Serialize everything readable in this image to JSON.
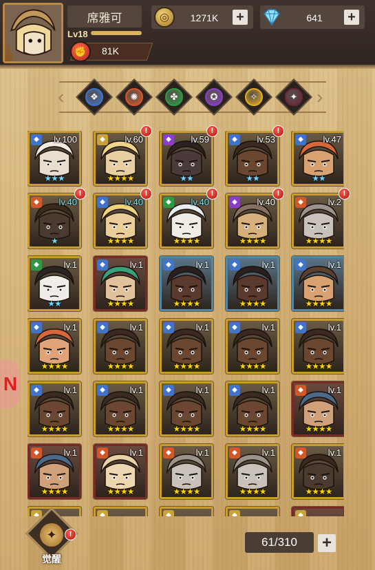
{
  "player": {
    "name": "席雅可",
    "level": "Lv18",
    "xp_fraction": 1.0,
    "power": "81K"
  },
  "resources": {
    "gold": {
      "value": "1271K",
      "icon": "gold-coin-icon"
    },
    "diamond": {
      "value": "641",
      "icon": "diamond-icon"
    }
  },
  "filters": [
    {
      "name": "element-water",
      "color": "#3f74c8",
      "glyph": "❖"
    },
    {
      "name": "element-fire",
      "color": "#d2582a",
      "glyph": "✺"
    },
    {
      "name": "element-nature",
      "color": "#2f9a46",
      "glyph": "✤"
    },
    {
      "name": "element-dark",
      "color": "#8a3fc4",
      "glyph": "✪"
    },
    {
      "name": "element-light",
      "color": "#e2ad1e",
      "glyph": "✧"
    },
    {
      "name": "element-shadow",
      "color": "#6a2a3a",
      "glyph": "✦"
    }
  ],
  "heroes": [
    {
      "lvl": "lv.100",
      "stars": "★★★",
      "starColor": "blue",
      "frame": "gold",
      "cls": "#3f74c8",
      "face": "#e9ddd0",
      "hair": "#f2ede4",
      "lvlColor": "white",
      "badge": false
    },
    {
      "lvl": "lv.60",
      "stars": "★★★★",
      "starColor": "gold",
      "frame": "gold",
      "cls": "#c9a23a",
      "face": "#e8cfa2",
      "hair": "#efd58a",
      "lvlColor": "white",
      "badge": true
    },
    {
      "lvl": "lv.59",
      "stars": "★★",
      "starColor": "blue",
      "frame": "gold",
      "cls": "#8a3fc4",
      "face": "#4a3a3a",
      "hair": "#2b2222",
      "lvlColor": "white",
      "badge": true
    },
    {
      "lvl": "lv.53",
      "stars": "★★",
      "starColor": "blue",
      "frame": "gold",
      "cls": "#3f74c8",
      "face": "#6b4631",
      "hair": "#3a2a22",
      "lvlColor": "white",
      "badge": true
    },
    {
      "lvl": "lv.47",
      "stars": "★★",
      "starColor": "blue",
      "frame": "gold",
      "cls": "#3f74c8",
      "face": "#d9a070",
      "hair": "#d6673a",
      "lvlColor": "white",
      "badge": false
    },
    {
      "lvl": "lv.40",
      "stars": "★",
      "starColor": "blue",
      "frame": "gold",
      "cls": "#d2582a",
      "face": "#4a3a30",
      "hair": "#3a2a1e",
      "lvlColor": "cyan",
      "badge": true
    },
    {
      "lvl": "lv.40",
      "stars": "★★★★",
      "starColor": "gold",
      "frame": "gold",
      "cls": "#3f74c8",
      "face": "#e9ce9a",
      "hair": "#f0d27a",
      "lvlColor": "cyan",
      "badge": true
    },
    {
      "lvl": "lv.40",
      "stars": "★★★★",
      "starColor": "gold",
      "frame": "gold",
      "cls": "#2f9a46",
      "face": "#f2ece6",
      "hair": "#e8eef2",
      "lvlColor": "cyan",
      "badge": true
    },
    {
      "lvl": "lv.40",
      "stars": "★★★★",
      "starColor": "gold",
      "frame": "gold",
      "cls": "#8a3fc4",
      "face": "#d5b07a",
      "hair": "#8a7060",
      "lvlColor": "white",
      "badge": true
    },
    {
      "lvl": "lv.2",
      "stars": "★★★★",
      "starColor": "gold",
      "frame": "gold",
      "cls": "#d2582a",
      "face": "#c8c2bb",
      "hair": "#9a938c",
      "lvlColor": "white",
      "badge": true
    },
    {
      "lvl": "lv.1",
      "stars": "★★",
      "starColor": "blue",
      "frame": "gold",
      "cls": "#2f9a46",
      "face": "#f0ede8",
      "hair": "#2b2523",
      "lvlColor": "white",
      "badge": false
    },
    {
      "lvl": "lv.1",
      "stars": "★★★★",
      "starColor": "gold",
      "frame": "red",
      "cls": "#3f74c8",
      "face": "#e2c29a",
      "hair": "#3aa07c",
      "lvlColor": "white",
      "badge": false
    },
    {
      "lvl": "lv.1",
      "stars": "★★★★",
      "starColor": "gold",
      "frame": "blue",
      "cls": "#3f74c8",
      "face": "#5a3a2c",
      "hair": "#2a2020",
      "lvlColor": "white",
      "badge": false
    },
    {
      "lvl": "lv.1",
      "stars": "★★★★",
      "starColor": "gold",
      "frame": "blue",
      "cls": "#3f74c8",
      "face": "#5a3a2c",
      "hair": "#2a2020",
      "lvlColor": "white",
      "badge": false
    },
    {
      "lvl": "lv.1",
      "stars": "★★★★",
      "starColor": "gold",
      "frame": "blue",
      "cls": "#3f74c8",
      "face": "#d9a070",
      "hair": "#5a4030",
      "lvlColor": "white",
      "badge": false
    },
    {
      "lvl": "lv.1",
      "stars": "★★★★",
      "starColor": "gold",
      "frame": "gold",
      "cls": "#3f74c8",
      "face": "#e0a478",
      "hair": "#d6673a",
      "lvlColor": "white",
      "badge": false
    },
    {
      "lvl": "lv.1",
      "stars": "★★★★",
      "starColor": "gold",
      "frame": "gold",
      "cls": "#3f74c8",
      "face": "#6b4631",
      "hair": "#3a2a22",
      "lvlColor": "white",
      "badge": false
    },
    {
      "lvl": "lv.1",
      "stars": "★★★★",
      "starColor": "gold",
      "frame": "gold",
      "cls": "#3f74c8",
      "face": "#6b4631",
      "hair": "#3a2a22",
      "lvlColor": "white",
      "badge": false
    },
    {
      "lvl": "lv.1",
      "stars": "★★★★",
      "starColor": "gold",
      "frame": "gold",
      "cls": "#3f74c8",
      "face": "#6b4631",
      "hair": "#3a2a22",
      "lvlColor": "white",
      "badge": false
    },
    {
      "lvl": "lv.1",
      "stars": "★★★★",
      "starColor": "gold",
      "frame": "gold",
      "cls": "#3f74c8",
      "face": "#6b4631",
      "hair": "#3a2a22",
      "lvlColor": "white",
      "badge": false
    },
    {
      "lvl": "lv.1",
      "stars": "★★★★",
      "starColor": "gold",
      "frame": "gold",
      "cls": "#3f74c8",
      "face": "#6b4631",
      "hair": "#3a2a22",
      "lvlColor": "white",
      "badge": false
    },
    {
      "lvl": "lv.1",
      "stars": "★★★★",
      "starColor": "gold",
      "frame": "gold",
      "cls": "#3f74c8",
      "face": "#6b4631",
      "hair": "#3a2a22",
      "lvlColor": "white",
      "badge": false
    },
    {
      "lvl": "lv.1",
      "stars": "★★★★",
      "starColor": "gold",
      "frame": "gold",
      "cls": "#3f74c8",
      "face": "#6b4631",
      "hair": "#3a2a22",
      "lvlColor": "white",
      "badge": false
    },
    {
      "lvl": "lv.1",
      "stars": "★★★★",
      "starColor": "gold",
      "frame": "gold",
      "cls": "#3f74c8",
      "face": "#6b4631",
      "hair": "#3a2a22",
      "lvlColor": "white",
      "badge": false
    },
    {
      "lvl": "lv.1",
      "stars": "★★★★",
      "starColor": "gold",
      "frame": "red",
      "cls": "#d2582a",
      "face": "#d0a07a",
      "hair": "#4a6a8a",
      "lvlColor": "white",
      "badge": false
    },
    {
      "lvl": "lv.1",
      "stars": "★★★★",
      "starColor": "gold",
      "frame": "red",
      "cls": "#d2582a",
      "face": "#d0a07a",
      "hair": "#4a6a8a",
      "lvlColor": "white",
      "badge": false
    },
    {
      "lvl": "lv.1",
      "stars": "★★★★",
      "starColor": "gold",
      "frame": "red",
      "cls": "#d2582a",
      "face": "#ecd7b0",
      "hair": "#e6d2a4",
      "lvlColor": "white",
      "badge": false
    },
    {
      "lvl": "lv.1",
      "stars": "★★★★",
      "starColor": "gold",
      "frame": "gold",
      "cls": "#d2582a",
      "face": "#c8c2bb",
      "hair": "#9a938c",
      "lvlColor": "white",
      "badge": false
    },
    {
      "lvl": "lv.1",
      "stars": "★★★★",
      "starColor": "gold",
      "frame": "gold",
      "cls": "#d2582a",
      "face": "#c8c2bb",
      "hair": "#9a938c",
      "lvlColor": "white",
      "badge": false
    },
    {
      "lvl": "lv.1",
      "stars": "★★★★",
      "starColor": "gold",
      "frame": "gold",
      "cls": "#d2582a",
      "face": "#4a3a30",
      "hair": "#3a2a1e",
      "lvlColor": "white",
      "badge": false
    },
    {
      "lvl": "",
      "stars": "",
      "starColor": "gold",
      "frame": "gold",
      "cls": "#c9a23a",
      "face": "#c9a062",
      "hair": "#8a6a3a",
      "lvlColor": "white",
      "badge": false
    },
    {
      "lvl": "",
      "stars": "",
      "starColor": "gold",
      "frame": "gold",
      "cls": "#c9a23a",
      "face": "#c9a062",
      "hair": "#8a6a3a",
      "lvlColor": "white",
      "badge": false
    },
    {
      "lvl": "",
      "stars": "",
      "starColor": "gold",
      "frame": "gold",
      "cls": "#c9a23a",
      "face": "#c9a062",
      "hair": "#8a6a3a",
      "lvlColor": "white",
      "badge": false
    },
    {
      "lvl": "",
      "stars": "",
      "starColor": "gold",
      "frame": "gold",
      "cls": "#c9a23a",
      "face": "#c9a062",
      "hair": "#8a6a3a",
      "lvlColor": "white",
      "badge": false
    },
    {
      "lvl": "",
      "stars": "",
      "starColor": "gold",
      "frame": "red",
      "cls": "#c9a23a",
      "face": "#c9a062",
      "hair": "#8a6a3a",
      "lvlColor": "white",
      "badge": false
    }
  ],
  "bottom": {
    "awaken_label": "觉醒",
    "hero_count": "61/310"
  }
}
